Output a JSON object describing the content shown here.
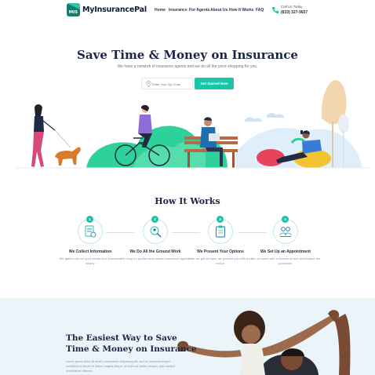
{
  "header": {
    "logo_badge": "MIS",
    "logo_text": "MyInsurancePal",
    "nav": [
      "Home",
      "Insurance",
      "For Agents",
      "About Us",
      "How It Works",
      "FAQ"
    ],
    "call_label": "Call Us Today",
    "call_number": "(833) 327-9657"
  },
  "hero": {
    "title": "Save Time & Money on Insurance",
    "subtitle": "We have a network of insurance agents and we do all the price shopping for you.",
    "zip_placeholder": "Enter Your Zip Code",
    "cta_label": "Get Started Now"
  },
  "how": {
    "title": "How It Works",
    "steps": [
      {
        "num": "1",
        "title": "We Collect Information",
        "desc": "We gather info on your needs and insurance history."
      },
      {
        "num": "2",
        "title": "We Do All the Ground Work",
        "desc": "We shop for quotes and contact insurance agents."
      },
      {
        "num": "3",
        "title": "We Present Your Options",
        "desc": "After we get all data, we present you with your choice."
      },
      {
        "num": "4",
        "title": "We Set Up an Appointment",
        "desc": "You sit down with a chosen broker and finalize the purchase."
      }
    ]
  },
  "bottom": {
    "title_line1": "The Easiest Way to Save",
    "title_line2": "Time & Money on Insurance",
    "text": "Lorem ipsum dolor sit amet, consectetur adipiscing elit, sed do eiusmod tempor incididunt ut labore et dolore magna aliqua. Ut enim ad minim veniam, quis nostrud exercitation ullamco."
  },
  "colors": {
    "accent": "#19c5a6",
    "brand_dark": "#0f7f6d",
    "title": "#1c2545",
    "bottom_bg": "#eaf4f9"
  },
  "icons": [
    "phone-icon",
    "location-pin-icon",
    "info-form-icon",
    "search-magnifier-icon",
    "clipboard-icon",
    "meeting-people-icon"
  ]
}
